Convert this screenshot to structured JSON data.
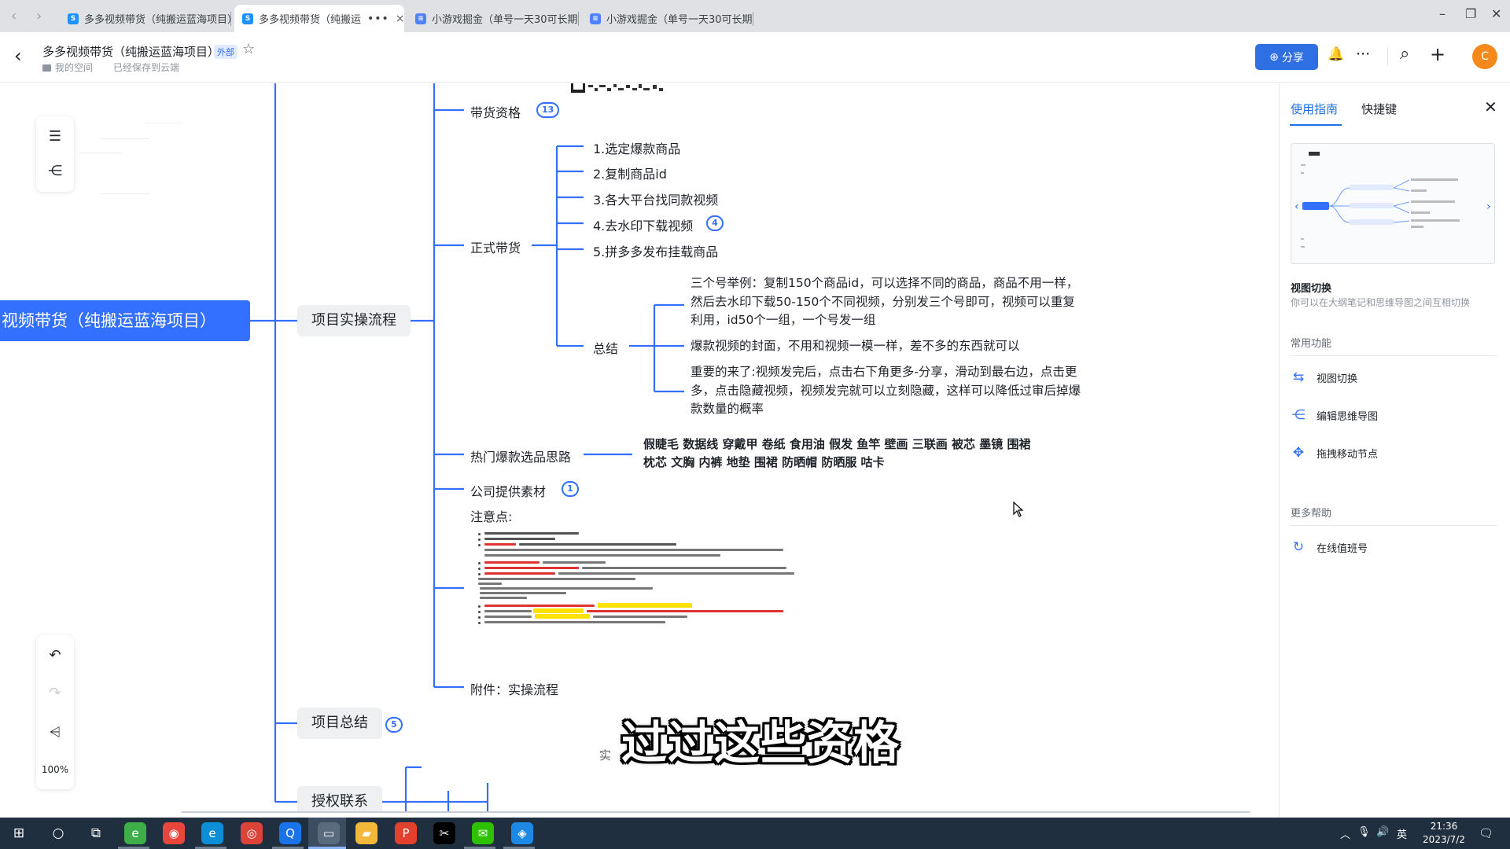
{
  "browser": {
    "tabs": [
      {
        "label": "多多视频带货（纯搬运蓝海项目）",
        "color": "#1e90ff",
        "glyph": "S"
      },
      {
        "label": "多多视频带货（纯搬运",
        "color": "#1e90ff",
        "glyph": "S",
        "more": "•••",
        "close": "×"
      },
      {
        "label": "小游戏掘金（单号一天30可长期）",
        "color": "#4e83fd",
        "glyph": "≡"
      },
      {
        "label": "小游戏掘金（单号一天30可长期）",
        "color": "#4e83fd",
        "glyph": "≡"
      }
    ],
    "window_controls": {
      "minimize": "–",
      "restore": "❐",
      "close": "✕"
    }
  },
  "header": {
    "back": "‹",
    "title": "多多视频带货（纯搬运蓝海项目）",
    "badge": "外部",
    "star": "☆",
    "breadcrumb_space": "我的空间",
    "save_status": "已经保存到云端",
    "share_label": "分享",
    "share_icon": "⊕",
    "bell": "🔔",
    "more": "···",
    "search": "⌕",
    "plus": "+",
    "avatar_letter": "C",
    "accent_color": "#2f6fe4"
  },
  "mindmap": {
    "root": "视频带货（纯搬运蓝海项目）",
    "branches": {
      "process": "项目实操流程",
      "summary": "项目总结",
      "summary_count": "5",
      "contact": "授权联系"
    },
    "process_children": {
      "qualification": "带货资格",
      "qualification_count": "13",
      "formal": "正式带货",
      "hot": "热门爆款选品思路",
      "materials": "公司提供素材",
      "materials_count": "1",
      "notes": "注意点:",
      "attachment": "附件：实操流程"
    },
    "formal_steps": [
      {
        "label": "1.选定爆款商品"
      },
      {
        "label": "2.复制商品id"
      },
      {
        "label": "3.各大平台找同款视频"
      },
      {
        "label": "4.去水印下载视频",
        "count": "4"
      },
      {
        "label": "5.拼多多发布挂载商品"
      }
    ],
    "summary_node": "总结",
    "summary_paragraphs": [
      "三个号举例：复制150个商品id，可以选择不同的商品，商品不用一样，然后去水印下载50-150个不同视频，分别发三个号即可，视频可以重复利用，id50个一组，一个号发一组",
      "爆款视频的封面，不用和视频一模一样，差不多的东西就可以",
      "重要的来了:视频发完后，点击右下角更多-分享，滑动到最右边，点击更多，点击隐藏视频，视频发完就可以立刻隐藏，这样可以降低过审后掉爆款数量的概率"
    ],
    "hot_items": "假睫毛 数据线 穿戴甲 卷纸 食用油 假发 鱼竿 壁画 三联画 被芯 墨镜 围裙 枕芯 文胸 内裤 地垫 围裙 防晒帽 防晒服 咕卡",
    "partial_text": "实",
    "zoom": "100%"
  },
  "toolbar_icons": {
    "outline": "☰",
    "mindmap": "⋲",
    "undo": "↶",
    "redo": "↷",
    "layout": "⩤"
  },
  "subtitle": "过过这些资格",
  "help_panel": {
    "tabs": [
      "使用指南",
      "快捷键"
    ],
    "close": "✕",
    "feature_title": "视图切换",
    "feature_desc": "你可以在大纲笔记和思维导图之间互相切换",
    "common_title": "常用功能",
    "common_items": [
      {
        "label": "视图切换",
        "icon": "⇆"
      },
      {
        "label": "编辑思维导图",
        "icon": "⋲"
      },
      {
        "label": "拖拽移动节点",
        "icon": "✥"
      }
    ],
    "more_title": "更多帮助",
    "more_items": [
      {
        "label": "在线值班号",
        "icon": "↻"
      }
    ]
  },
  "taskbar": {
    "time": "21:36",
    "date": "2023/7/2",
    "ime": "英",
    "apps": [
      {
        "name": "start",
        "glyph": "⊞",
        "color": "transparent"
      },
      {
        "name": "search",
        "glyph": "○",
        "color": "transparent"
      },
      {
        "name": "task-view",
        "glyph": "⧉",
        "color": "transparent"
      },
      {
        "name": "browser-green",
        "glyph": "e",
        "color": "#3fae49"
      },
      {
        "name": "browser-multi",
        "glyph": "◉",
        "color": "#e8453c"
      },
      {
        "name": "edge",
        "glyph": "e",
        "color": "#0c8fd6"
      },
      {
        "name": "chrome",
        "glyph": "◎",
        "color": "#db4437"
      },
      {
        "name": "search-app",
        "glyph": "Q",
        "color": "#1a73e8"
      },
      {
        "name": "screen-app",
        "glyph": "▭",
        "color": "#5a6b7d"
      },
      {
        "name": "explorer",
        "glyph": "▰",
        "color": "#f3b73a"
      },
      {
        "name": "office",
        "glyph": "P",
        "color": "#e3402d"
      },
      {
        "name": "capcut",
        "glyph": "✂",
        "color": "#000000"
      },
      {
        "name": "wechat",
        "glyph": "✉",
        "color": "#2dc100"
      },
      {
        "name": "app-blue",
        "glyph": "◈",
        "color": "#1e88e5"
      }
    ]
  }
}
